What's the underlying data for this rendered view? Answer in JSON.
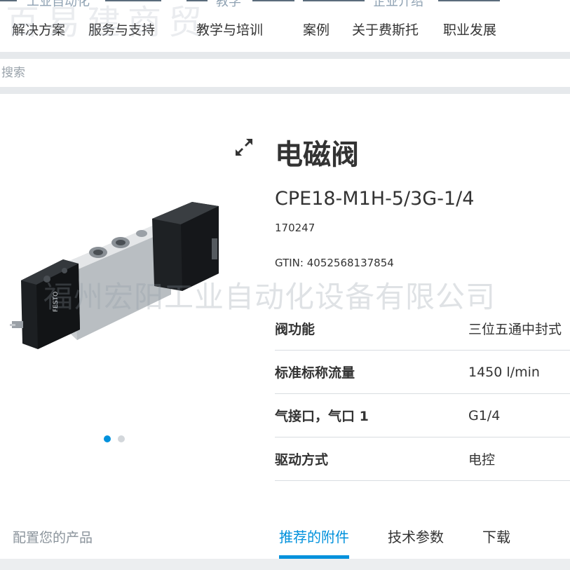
{
  "top_nav": {
    "cut_labels": [
      "工业自动化",
      "教学",
      "企业介绍"
    ],
    "items": [
      "解决方案",
      "服务与支持",
      "教学与培训",
      "案例",
      "关于费斯托",
      "职业发展"
    ],
    "watermark": "百易建商贸"
  },
  "search": {
    "placeholder": "搜索"
  },
  "product": {
    "title": "电磁阀",
    "model": "CPE18-M1H-5/3G-1/4",
    "part_number": "170247",
    "gtin_label": "GTIN:",
    "gtin_value": "4052568137854",
    "expand_icon": "expand-arrows-icon",
    "image_count": 2,
    "active_image_index": 0,
    "specs": [
      {
        "key": "阀功能",
        "value": "三位五通中封式"
      },
      {
        "key": "标准标称流量",
        "value": "1450 l/min"
      },
      {
        "key": "气接口，气口 1",
        "value": "G1/4"
      },
      {
        "key": "驱动方式",
        "value": "电控"
      }
    ],
    "image_lettering": "FESTO"
  },
  "watermark_text": "福州宏阳工业自动化设备有限公司",
  "bottom": {
    "configure_label": "配置您的产品",
    "tabs": [
      "推荐的附件",
      "技术参数",
      "下载"
    ],
    "active_tab_index": 0
  },
  "colors": {
    "accent": "#0091dc",
    "text": "#333333",
    "muted": "#8a939b",
    "band": "#e6e9ec"
  }
}
